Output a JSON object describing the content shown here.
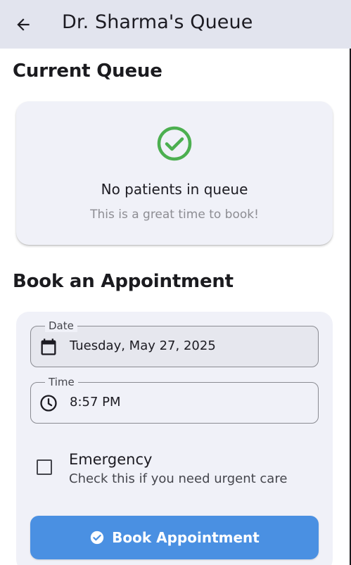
{
  "appbar": {
    "title": "Dr. Sharma's Queue",
    "back_icon": "arrow-left-icon"
  },
  "queue_section": {
    "title": "Current Queue",
    "status_icon": "check-circle-icon",
    "status_color": "#4caf50",
    "empty_title": "No patients in queue",
    "empty_subtitle": "This is a great time to book!"
  },
  "booking_section": {
    "title": "Book an Appointment",
    "date_field": {
      "label": "Date",
      "value": "Tuesday, May 27, 2025",
      "icon": "calendar-icon"
    },
    "time_field": {
      "label": "Time",
      "value": "8:57 PM",
      "icon": "clock-icon"
    },
    "emergency": {
      "title": "Emergency",
      "subtitle": "Check this if you need urgent care",
      "checked": false
    },
    "submit": {
      "label": "Book Appointment",
      "icon": "check-circle-icon",
      "color": "#4a90e2"
    }
  }
}
